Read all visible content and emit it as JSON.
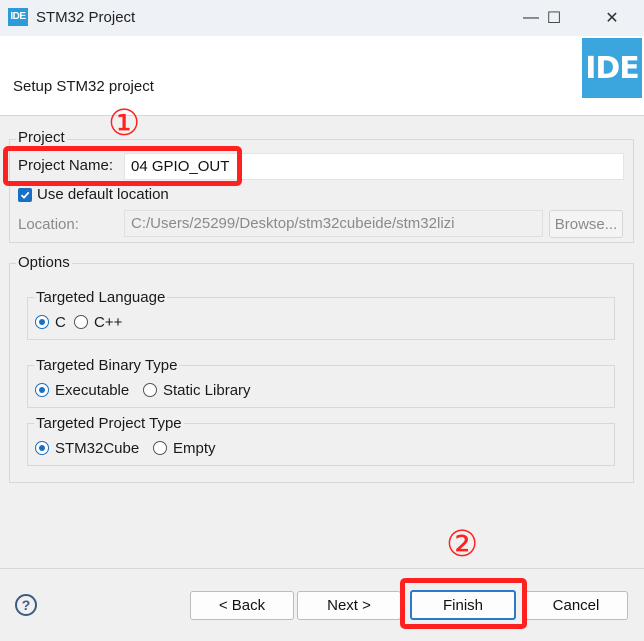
{
  "window": {
    "app_icon_text": "IDE",
    "title": "STM32 Project",
    "minimize_glyph": "—",
    "maximize_glyph": "☐",
    "close_glyph": "✕"
  },
  "header": {
    "title": "Setup STM32 project",
    "logo_text": "IDE",
    "logo_color": "#3aa6dd"
  },
  "project": {
    "group_label": "Project",
    "name_label": "Project Name:",
    "name_value": "04 GPIO_OUT",
    "use_default_label": "Use default location",
    "use_default_checked": true,
    "location_label": "Location:",
    "location_value": "C:/Users/25299/Desktop/stm32cubeide/stm32lizi",
    "browse_label": "Browse..."
  },
  "options": {
    "group_label": "Options",
    "language": {
      "label": "Targeted Language",
      "choices": [
        "C",
        "C++"
      ],
      "selected": "C"
    },
    "binary": {
      "label": "Targeted Binary Type",
      "choices": [
        "Executable",
        "Static Library"
      ],
      "selected": "Executable"
    },
    "project_type": {
      "label": "Targeted Project Type",
      "choices": [
        "STM32Cube",
        "Empty"
      ],
      "selected": "STM32Cube"
    }
  },
  "buttons": {
    "help_glyph": "?",
    "back": "< Back",
    "next": "Next >",
    "finish": "Finish",
    "cancel": "Cancel"
  },
  "annotations": {
    "marker_1": "①",
    "marker_2": "②",
    "highlight_color": "#ff2020"
  }
}
